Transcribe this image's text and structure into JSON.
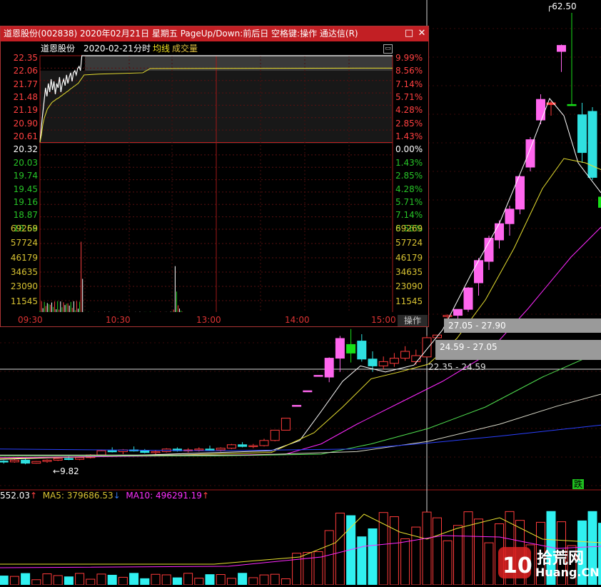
{
  "window": {
    "title": "道恩股份(002838)  2020年02月21日  星期五  PageUp/Down:前后日  空格键:操作  通达信(R)",
    "restore_icon": "square-icon",
    "close_icon": "close-icon"
  },
  "intraday_header": {
    "stock_name": "道恩股份",
    "date": "2020-02-21",
    "chart_kind": "分时",
    "avg_line_label": "均线",
    "volume_label": "成交量"
  },
  "price_axis_left": [
    "22.35",
    "22.06",
    "21.77",
    "21.48",
    "21.19",
    "20.90",
    "20.61",
    "20.32",
    "20.03",
    "19.74",
    "19.45",
    "19.16",
    "18.87",
    "18.58"
  ],
  "price_axis_right": [
    "9.99%",
    "8.56%",
    "7.14%",
    "5.71%",
    "4.28%",
    "2.85%",
    "1.43%",
    "0.00%",
    "1.43%",
    "2.85%",
    "4.28%",
    "5.71%",
    "7.14%",
    "8.56%"
  ],
  "volume_axis": [
    "69269",
    "57724",
    "46179",
    "34635",
    "23090",
    "11545"
  ],
  "time_axis": [
    "09:30",
    "10:30",
    "13:00",
    "14:00",
    "15:00"
  ],
  "operate_button": "操作",
  "main_chart": {
    "high_label": "62.50",
    "low_label": "9.82",
    "price_bands": [
      "27.05 - 27.90",
      "24.59 - 27.05",
      "22.35 - 24.59"
    ],
    "status_char": "跌"
  },
  "indicator_bar": {
    "vol_text": "552.03",
    "vol_arrow": "↑",
    "ma5_label": "MA5: 379686.53",
    "ma5_arrow": "↓",
    "ma10_label": "MA10: 496291.19",
    "ma10_arrow": "↑"
  },
  "watermark": {
    "text_top": "拾荒网",
    "text_bottom": "Huang.CN",
    "logo": "10"
  },
  "colors": {
    "up": "#ff3b3b",
    "down": "#00e0e0",
    "limit_up": "#ff66ee",
    "big_down": "#18e018",
    "avg": "#e8e030",
    "ma10": "#ff28ff",
    "ma20": "#50e050"
  },
  "chart_data": {
    "type": "candlestick",
    "title": "道恩股份(002838)",
    "intraday": {
      "date": "2020-02-21",
      "prev_close": 20.32,
      "limit_price": 22.35,
      "ylim": [
        18.29,
        22.35
      ],
      "time_ticks": [
        "09:30",
        "10:30",
        "13:00",
        "14:00",
        "15:00"
      ]
    },
    "daily": {
      "high_label": 62.5,
      "low_label": 9.82,
      "price_bands": [
        [
          27.05,
          27.9
        ],
        [
          24.59,
          27.05
        ],
        [
          22.35,
          24.59
        ]
      ]
    }
  }
}
